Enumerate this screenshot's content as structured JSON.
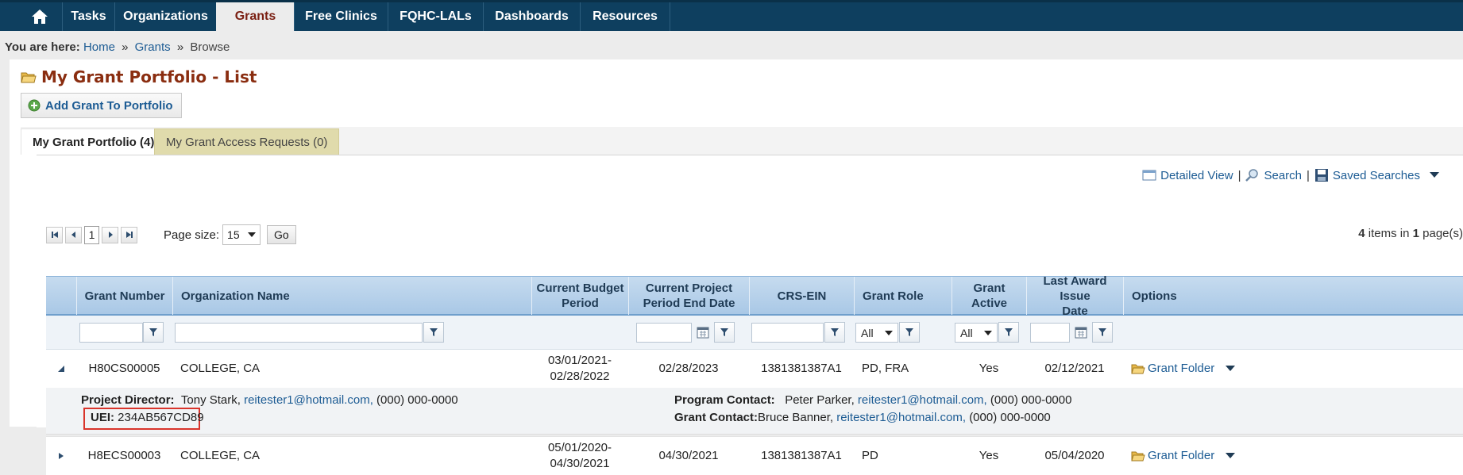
{
  "nav": {
    "items": [
      {
        "label": "Tasks"
      },
      {
        "label": "Organizations"
      },
      {
        "label": "Grants"
      },
      {
        "label": "Free Clinics"
      },
      {
        "label": "FQHC-LALs"
      },
      {
        "label": "Dashboards"
      },
      {
        "label": "Resources"
      }
    ],
    "active": "Grants"
  },
  "breadcrumb": {
    "prefix": "You are here:",
    "items": [
      "Home",
      "Grants",
      "Browse"
    ],
    "sep": "»"
  },
  "page": {
    "title": "My Grant Portfolio - List",
    "add_button": "Add Grant To Portfolio"
  },
  "tabs": [
    {
      "label": "My Grant Portfolio (4)"
    },
    {
      "label": "My Grant Access Requests (0)"
    }
  ],
  "toolbar": {
    "detailed_view": "Detailed View",
    "sep": "|",
    "search": "Search",
    "saved_searches": "Saved Searches"
  },
  "pager": {
    "current_page": "1",
    "page_size_label": "Page size:",
    "page_size": "15",
    "go": "Go",
    "items_count": "4",
    "items_text": "items in",
    "pages_count": "1",
    "pages_text": "page(s)"
  },
  "columns": {
    "grant_number": "Grant Number",
    "org_name": "Organization Name",
    "budget_period_1": "Current Budget",
    "budget_period_2": "Period",
    "project_end_1": "Current Project",
    "project_end_2": "Period End Date",
    "crs_ein": "CRS-EIN",
    "grant_role": "Grant Role",
    "grant_active": "Grant Active",
    "last_award_1": "Last Award Issue",
    "last_award_2": "Date",
    "options": "Options"
  },
  "filters": {
    "grant_role": "All",
    "grant_active": "All"
  },
  "rows": [
    {
      "grant_number": "H80CS00005",
      "org_name": "COLLEGE, CA",
      "budget_1": "03/01/2021-",
      "budget_2": "02/28/2022",
      "project_end": "02/28/2023",
      "crs_ein": "1381381387A1",
      "grant_role": "PD, FRA",
      "grant_active": "Yes",
      "last_award": "02/12/2021",
      "option": "Grant Folder"
    },
    {
      "grant_number": "H8ECS00003",
      "org_name": "COLLEGE, CA",
      "budget_1": "05/01/2020-",
      "budget_2": "04/30/2021",
      "project_end": "04/30/2021",
      "crs_ein": "1381381387A1",
      "grant_role": "PD",
      "grant_active": "Yes",
      "last_award": "05/04/2020",
      "option": "Grant Folder"
    }
  ],
  "detail": {
    "pd_label": "Project Director:",
    "pd_name": "Tony Stark,",
    "pd_email": "reitester1@hotmail.com,",
    "pd_phone": "(000) 000-0000",
    "uei_label": "UEI:",
    "uei_value": "234AB567CD89",
    "pc_label": "Program Contact:",
    "pc_name": "Peter Parker,",
    "pc_email": "reitester1@hotmail.com,",
    "pc_phone": "(000) 000-0000",
    "gc_label": "Grant Contact:",
    "gc_name": "Bruce Banner,",
    "gc_email": "reitester1@hotmail.com,",
    "gc_phone": "(000) 000-0000"
  },
  "colors": {
    "nav_bg": "#0e3f5f",
    "title": "#8a2d10",
    "link": "#1d5c94",
    "highlight": "#d9342b"
  }
}
